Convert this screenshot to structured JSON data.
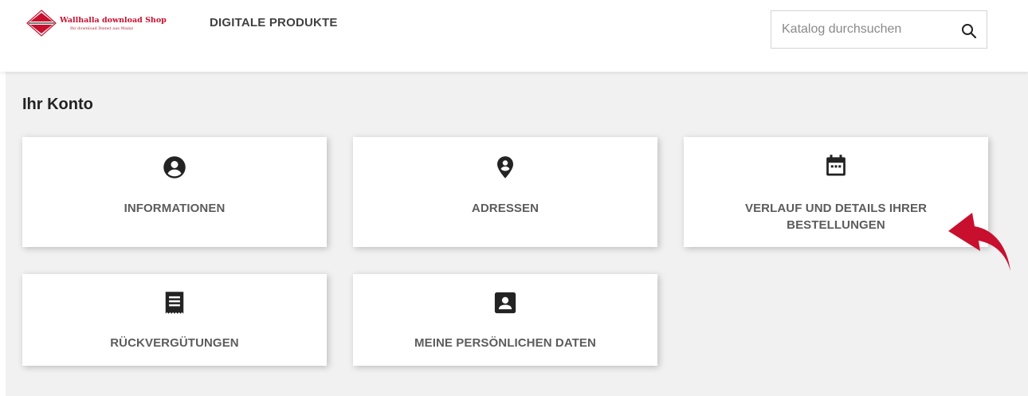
{
  "header": {
    "logo": {
      "title": "Wallhalla download Shop",
      "tagline": "Ihr download Dienst aus Mainz",
      "brand_color": "#c8102e"
    },
    "nav": {
      "digital_products": "DIGITALE PRODUKTE"
    },
    "search": {
      "placeholder": "Katalog durchsuchen",
      "value": "",
      "icon": "search-icon"
    }
  },
  "main": {
    "title": "Ihr Konto",
    "cards": [
      {
        "id": "informationen",
        "label": "INFORMATIONEN",
        "icon": "account-circle-icon"
      },
      {
        "id": "adressen",
        "label": "ADRESSEN",
        "icon": "location-pin-icon"
      },
      {
        "id": "bestellungen",
        "label_line1": "VERLAUF UND DETAILS IHRER",
        "label_line2": "BESTELLUNGEN",
        "icon": "calendar-icon"
      },
      {
        "id": "rueckverguetungen",
        "label": "RÜCKVERGÜTUNGEN",
        "icon": "receipt-icon"
      },
      {
        "id": "persoenliche-daten",
        "label": "MEINE PERSÖNLICHEN DATEN",
        "icon": "contact-card-icon"
      }
    ]
  },
  "annotation": {
    "arrow_color": "#c8102e",
    "points_to": "bestellungen"
  }
}
